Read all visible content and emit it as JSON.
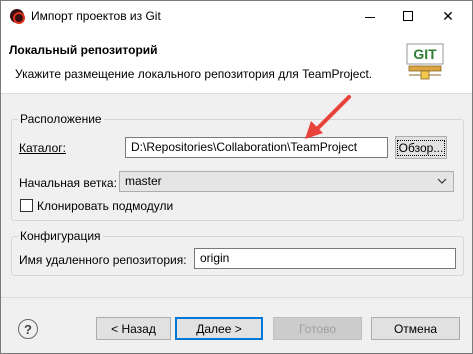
{
  "window": {
    "title": "Импорт проектов из Git",
    "controls": {
      "minimize": "",
      "maximize": "",
      "close": "✕"
    }
  },
  "banner": {
    "title": "Локальный репозиторий",
    "description": "Укажите размещение локального репозитория для TeamProject.",
    "git_logo_text": "GIT"
  },
  "location": {
    "legend": "Расположение",
    "directory_label": "Каталог:",
    "directory_value": "D:\\Repositories\\Collaboration\\TeamProject",
    "browse_label": "Обзор...",
    "branch_label": "Начальная ветка:",
    "branch_value": "master",
    "clone_submodules_label": "Клонировать подмодули",
    "clone_submodules_checked": false
  },
  "configuration": {
    "legend": "Конфигурация",
    "remote_label": "Имя удаленного репозитория:",
    "remote_value": "origin"
  },
  "footer": {
    "help": "?",
    "back_label": "< Назад",
    "next_label": "Далее >",
    "finish_label": "Готово",
    "cancel_label": "Отмена"
  },
  "colors": {
    "accent": "#0078d7",
    "annotation_arrow": "#e8423a"
  }
}
